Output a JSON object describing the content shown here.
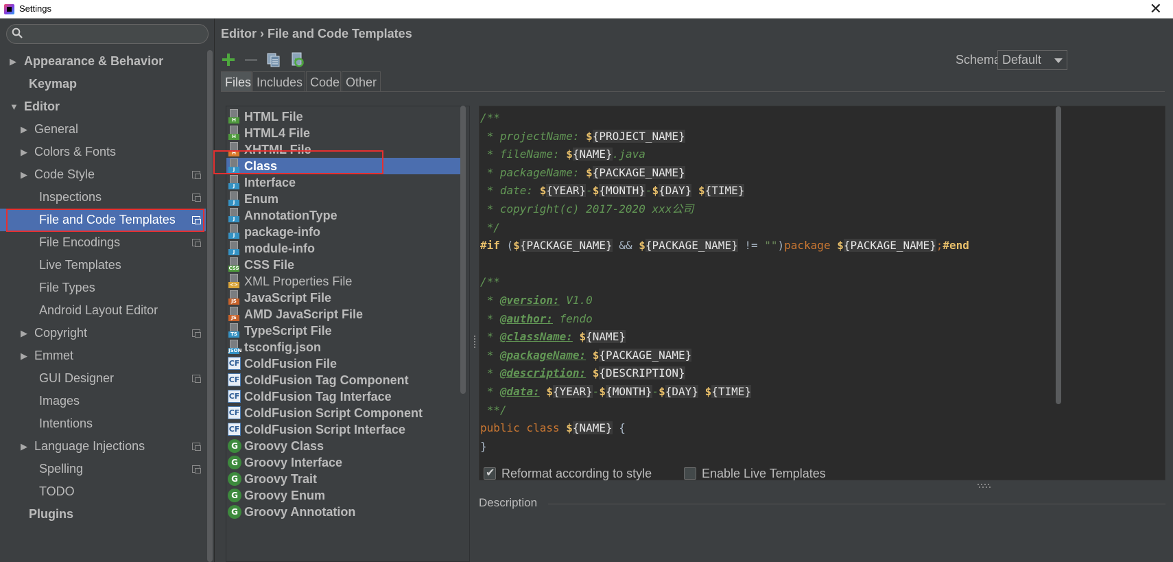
{
  "window": {
    "title": "Settings"
  },
  "search": {
    "placeholder": ""
  },
  "sidebar": {
    "items": [
      {
        "label": "Appearance & Behavior",
        "arrow": "▶",
        "level": 0,
        "bold": true
      },
      {
        "label": "Keymap",
        "arrow": "",
        "level": 0,
        "bold": true
      },
      {
        "label": "Editor",
        "arrow": "▼",
        "level": 0,
        "bold": true
      },
      {
        "label": "General",
        "arrow": "▶",
        "level": 1
      },
      {
        "label": "Colors & Fonts",
        "arrow": "▶",
        "level": 1
      },
      {
        "label": "Code Style",
        "arrow": "▶",
        "level": 1,
        "project": true
      },
      {
        "label": "Inspections",
        "arrow": "",
        "level": 2,
        "project": true
      },
      {
        "label": "File and Code Templates",
        "arrow": "",
        "level": 2,
        "project": true,
        "selected": true
      },
      {
        "label": "File Encodings",
        "arrow": "",
        "level": 2,
        "project": true
      },
      {
        "label": "Live Templates",
        "arrow": "",
        "level": 2
      },
      {
        "label": "File Types",
        "arrow": "",
        "level": 2
      },
      {
        "label": "Android Layout Editor",
        "arrow": "",
        "level": 2
      },
      {
        "label": "Copyright",
        "arrow": "▶",
        "level": 1,
        "project": true
      },
      {
        "label": "Emmet",
        "arrow": "▶",
        "level": 1
      },
      {
        "label": "GUI Designer",
        "arrow": "",
        "level": 2,
        "project": true
      },
      {
        "label": "Images",
        "arrow": "",
        "level": 2
      },
      {
        "label": "Intentions",
        "arrow": "",
        "level": 2
      },
      {
        "label": "Language Injections",
        "arrow": "▶",
        "level": 1,
        "project": true
      },
      {
        "label": "Spelling",
        "arrow": "",
        "level": 2,
        "project": true
      },
      {
        "label": "TODO",
        "arrow": "",
        "level": 2
      },
      {
        "label": "Plugins",
        "arrow": "",
        "level": 0,
        "bold": true
      }
    ]
  },
  "header": {
    "breadcrumb": "Editor › File and Code Templates"
  },
  "toolbar": {
    "add_icon": "plus-icon",
    "remove_icon": "minus-icon",
    "copy_icon": "copy-icon",
    "reset_icon": "reset-icon"
  },
  "schema": {
    "label": "Schema:",
    "value": "Default"
  },
  "tabs": [
    {
      "label": "Files",
      "active": true
    },
    {
      "label": "Includes"
    },
    {
      "label": "Code"
    },
    {
      "label": "Other"
    }
  ],
  "templates": [
    {
      "name": "HTML File",
      "icon": "file",
      "badge": "H",
      "badge_color": "#4f9a3d"
    },
    {
      "name": "HTML4 File",
      "icon": "file",
      "badge": "H",
      "badge_color": "#4f9a3d"
    },
    {
      "name": "XHTML File",
      "icon": "file",
      "badge": "H",
      "badge_color": "#d97a2a"
    },
    {
      "name": "Class",
      "icon": "file",
      "badge": "J",
      "badge_color": "#3592c4",
      "selected": true
    },
    {
      "name": "Interface",
      "icon": "file",
      "badge": "J",
      "badge_color": "#3592c4"
    },
    {
      "name": "Enum",
      "icon": "file",
      "badge": "J",
      "badge_color": "#3592c4"
    },
    {
      "name": "AnnotationType",
      "icon": "file",
      "badge": "J",
      "badge_color": "#3592c4"
    },
    {
      "name": "package-info",
      "icon": "file",
      "badge": "J",
      "badge_color": "#3592c4"
    },
    {
      "name": "module-info",
      "icon": "file",
      "badge": "J",
      "badge_color": "#3592c4"
    },
    {
      "name": "CSS File",
      "icon": "file",
      "badge": "CSS",
      "badge_color": "#4f9a3d"
    },
    {
      "name": "XML Properties File",
      "icon": "file",
      "badge": "<>",
      "badge_color": "#d9a43a",
      "normal": true
    },
    {
      "name": "JavaScript File",
      "icon": "file",
      "badge": "JS",
      "badge_color": "#c9622a"
    },
    {
      "name": "AMD JavaScript File",
      "icon": "file",
      "badge": "JS",
      "badge_color": "#c9622a"
    },
    {
      "name": "TypeScript File",
      "icon": "file",
      "badge": "TS",
      "badge_color": "#3592c4"
    },
    {
      "name": "tsconfig.json",
      "icon": "file",
      "badge": "JSON",
      "badge_color": "#3592c4"
    },
    {
      "name": "ColdFusion File",
      "icon": "cf",
      "badge": "CF"
    },
    {
      "name": "ColdFusion Tag Component",
      "icon": "cf",
      "badge": "CF"
    },
    {
      "name": "ColdFusion Tag Interface",
      "icon": "cf",
      "badge": "CF"
    },
    {
      "name": "ColdFusion Script Component",
      "icon": "cf",
      "badge": "CF"
    },
    {
      "name": "ColdFusion Script Interface",
      "icon": "cf",
      "badge": "CF"
    },
    {
      "name": "Groovy Class",
      "icon": "groovy",
      "badge": "G"
    },
    {
      "name": "Groovy Interface",
      "icon": "groovy",
      "badge": "G"
    },
    {
      "name": "Groovy Trait",
      "icon": "groovy",
      "badge": "G"
    },
    {
      "name": "Groovy Enum",
      "icon": "groovy",
      "badge": "G"
    },
    {
      "name": "Groovy Annotation",
      "icon": "groovy",
      "badge": "G"
    }
  ],
  "editor": {
    "lines": [
      [
        [
          "cm",
          "/**"
        ]
      ],
      [
        [
          "cm",
          " * projectName: "
        ],
        [
          "dol",
          "$"
        ],
        [
          "var",
          "{PROJECT_NAME}"
        ]
      ],
      [
        [
          "cm",
          " * fileName: "
        ],
        [
          "dol",
          "$"
        ],
        [
          "var",
          "{NAME}"
        ],
        [
          "cm",
          ".java"
        ]
      ],
      [
        [
          "cm",
          " * packageName: "
        ],
        [
          "dol",
          "$"
        ],
        [
          "var",
          "{PACKAGE_NAME}"
        ]
      ],
      [
        [
          "cm",
          " * date: "
        ],
        [
          "dol",
          "$"
        ],
        [
          "var",
          "{YEAR}"
        ],
        [
          "cm",
          "-"
        ],
        [
          "dol",
          "$"
        ],
        [
          "var",
          "{MONTH}"
        ],
        [
          "cm",
          "-"
        ],
        [
          "dol",
          "$"
        ],
        [
          "var",
          "{DAY}"
        ],
        [
          "cm",
          " "
        ],
        [
          "dol",
          "$"
        ],
        [
          "var",
          "{TIME}"
        ]
      ],
      [
        [
          "cm",
          " * copyright(c) 2017-2020 xxx公司"
        ]
      ],
      [
        [
          "cm",
          " */"
        ]
      ],
      [
        [
          "dir",
          "#if"
        ],
        [
          "op",
          " ("
        ],
        [
          "dol",
          "$"
        ],
        [
          "var",
          "{PACKAGE_NAME}"
        ],
        [
          "op",
          " && "
        ],
        [
          "dol",
          "$"
        ],
        [
          "var",
          "{PACKAGE_NAME}"
        ],
        [
          "op",
          " != "
        ],
        [
          "str",
          "\"\""
        ],
        [
          "op",
          ")"
        ],
        [
          "kw",
          "package "
        ],
        [
          "dol",
          "$"
        ],
        [
          "var",
          "{PACKAGE_NAME}"
        ],
        [
          "kw",
          ";"
        ],
        [
          "dir",
          "#end"
        ]
      ],
      [
        [
          "op",
          ""
        ]
      ],
      [
        [
          "cm",
          "/**"
        ]
      ],
      [
        [
          "cm",
          " * "
        ],
        [
          "tag",
          "@version:"
        ],
        [
          "cm",
          " V1.0"
        ]
      ],
      [
        [
          "cm",
          " * "
        ],
        [
          "tag",
          "@author:"
        ],
        [
          "cm",
          " fendo"
        ]
      ],
      [
        [
          "cm",
          " * "
        ],
        [
          "tag",
          "@className:"
        ],
        [
          "cm",
          " "
        ],
        [
          "dol",
          "$"
        ],
        [
          "var",
          "{NAME}"
        ]
      ],
      [
        [
          "cm",
          " * "
        ],
        [
          "tag",
          "@packageName:"
        ],
        [
          "cm",
          " "
        ],
        [
          "dol",
          "$"
        ],
        [
          "var",
          "{PACKAGE_NAME}"
        ]
      ],
      [
        [
          "cm",
          " * "
        ],
        [
          "tag",
          "@description:"
        ],
        [
          "cm",
          " "
        ],
        [
          "dol",
          "$"
        ],
        [
          "var",
          "{DESCRIPTION}"
        ]
      ],
      [
        [
          "cm",
          " * "
        ],
        [
          "tag",
          "@data:"
        ],
        [
          "cm",
          " "
        ],
        [
          "dol",
          "$"
        ],
        [
          "var",
          "{YEAR}"
        ],
        [
          "cm",
          "-"
        ],
        [
          "dol",
          "$"
        ],
        [
          "var",
          "{MONTH}"
        ],
        [
          "cm",
          "-"
        ],
        [
          "dol",
          "$"
        ],
        [
          "var",
          "{DAY}"
        ],
        [
          "cm",
          " "
        ],
        [
          "dol",
          "$"
        ],
        [
          "var",
          "{TIME}"
        ]
      ],
      [
        [
          "cm",
          " **/"
        ]
      ],
      [
        [
          "kw",
          "public class "
        ],
        [
          "dol",
          "$"
        ],
        [
          "var",
          "{NAME}"
        ],
        [
          "op",
          " {"
        ]
      ],
      [
        [
          "op",
          "}"
        ]
      ]
    ]
  },
  "options": {
    "reformat": {
      "label": "Reformat according to style",
      "checked": true
    },
    "live_templates": {
      "label": "Enable Live Templates",
      "checked": false
    }
  },
  "description": {
    "label": "Description"
  },
  "colors": {
    "selection": "#4b6eaf",
    "highlight": "#e53030",
    "background": "#3c3f41",
    "editor_bg": "#2b2b2b"
  }
}
